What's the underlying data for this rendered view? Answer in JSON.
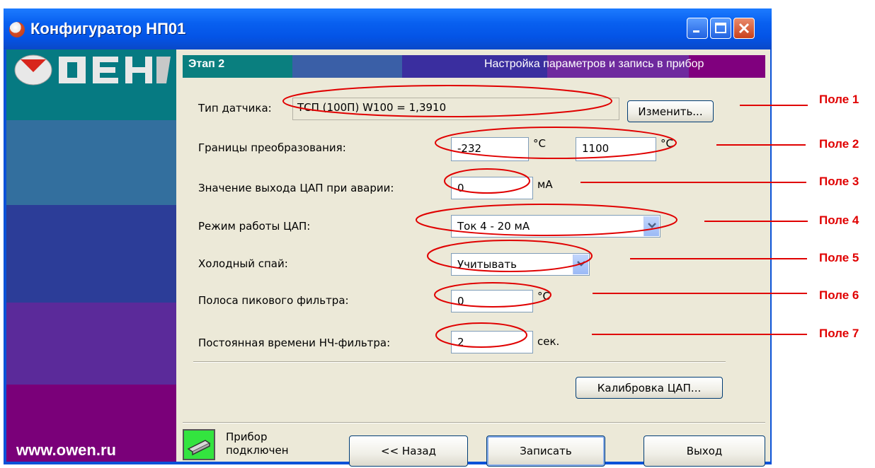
{
  "window": {
    "title": "Конфигуратор НП01"
  },
  "sidebar": {
    "url": "www.owen.ru",
    "logo_text": "OWEN",
    "colors": [
      "#067a82",
      "#336f9e",
      "#2c3d98",
      "#5b2a9a",
      "#7a0079"
    ]
  },
  "step": {
    "label": "Этап 2",
    "title": "Настройка параметров и запись в прибор",
    "colors": [
      "#0a7f7f",
      "#3a5fa7",
      "#3a2e9f",
      "#6f2a9e",
      "#80007e"
    ]
  },
  "form": {
    "sensor_type": {
      "label": "Тип датчика:",
      "value": "ТСП (100П) W100 = 1,3910",
      "button": "Изменить..."
    },
    "limits": {
      "label": "Границы преобразования:",
      "low": "-232",
      "low_unit": "°C",
      "high": "1100",
      "high_unit": "°C"
    },
    "dac_alarm": {
      "label": "Значение выхода ЦАП при аварии:",
      "value": "0",
      "unit": "мА"
    },
    "dac_mode": {
      "label": "Режим работы ЦАП:",
      "value": "Ток 4 - 20 мА"
    },
    "cold_junction": {
      "label": "Холодный спай:",
      "value": "Учитывать"
    },
    "peak_filter": {
      "label": "Полоса пикового фильтра:",
      "value": "0",
      "unit": "°C"
    },
    "lpf_const": {
      "label": "Постоянная времени НЧ-фильтра:",
      "value": "2",
      "unit": "сек."
    },
    "calibrate_button": "Калибровка ЦАП..."
  },
  "status": {
    "line1": "Прибор",
    "line2": "подключен"
  },
  "nav": {
    "back": "<< Назад",
    "write": "Записать",
    "exit": "Выход"
  },
  "annotations": [
    "Поле 1",
    "Поле 2",
    "Поле 3",
    "Поле 4",
    "Поле 5",
    "Поле 6",
    "Поле 7"
  ],
  "colors": {
    "titlebar": "#0454e6",
    "annotation": "#e00000",
    "dialog_bg": "#ece9d8"
  }
}
